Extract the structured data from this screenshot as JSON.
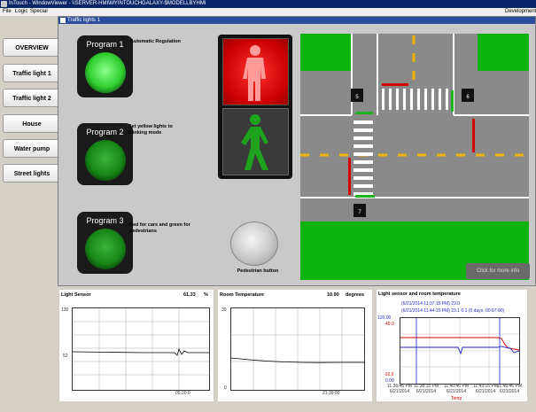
{
  "window": {
    "title": "InTouch - WindowViewer - \\\\SERVER-HMI\\MYINTOUCHGALAXY-$MODELLBYHMI"
  },
  "menu": {
    "items": [
      "File",
      "Logic",
      "Special"
    ],
    "right_label": "Development"
  },
  "nav": {
    "items": [
      "OVERVIEW",
      "Traffic light 1",
      "Traffic light 2",
      "House",
      "Water pump",
      "Street lights"
    ]
  },
  "panel": {
    "title": "Traffic lights 1"
  },
  "programs": [
    {
      "label": "Program 1",
      "desc": "Automatic Regulation",
      "active": true
    },
    {
      "label": "Program 2",
      "desc": "Set yellow lights to blinking mode",
      "active": false
    },
    {
      "label": "Program 3",
      "desc": "Red for cars and green for pedestrians",
      "active": false
    }
  ],
  "pedestrian": {
    "button_label": "Pedestrian button",
    "red_on": true,
    "green_on": false
  },
  "intersection": {
    "markers": [
      "5",
      "6",
      "7"
    ],
    "more_info": "Click for more info"
  },
  "charts": {
    "light": {
      "title": "Light Sensor",
      "value": "61.33",
      "unit": "%",
      "ytop": "130",
      "ymid": "52",
      "time": "05:20:0"
    },
    "room": {
      "title": "Room Temperature",
      "value": "10.90",
      "unit": "degrees",
      "ytop": "30",
      "ybottom": "0",
      "time": "21:39:00"
    },
    "combined": {
      "title": "Light sensor and room temperature",
      "line1": "(6/21/2014 11:37:15 PM) 23.0",
      "line2": "(6/21/2014 11:44:15 PM) 23.1  0.1  (0 days, 00:07:00)",
      "y_top_blue": "120.00",
      "y_top_red": "40.0",
      "y_bottom_red": "-10.0",
      "y_bottom_blue": "0.00",
      "xticks": [
        [
          "11:36:46 PM",
          "6/21/2014"
        ],
        [
          "11:38:15 PM",
          "6/21/2014"
        ],
        [
          "11:40:46 PM",
          "6/21/2014"
        ],
        [
          "11:43:15 PM",
          "6/21/2014"
        ],
        [
          "11:46:46 PM",
          "6/21/2014"
        ]
      ],
      "legend": "Temp"
    }
  },
  "colors": {
    "blue_series": "#1f1fcc",
    "red_series": "#d40000",
    "grass": "#0fb30f"
  }
}
